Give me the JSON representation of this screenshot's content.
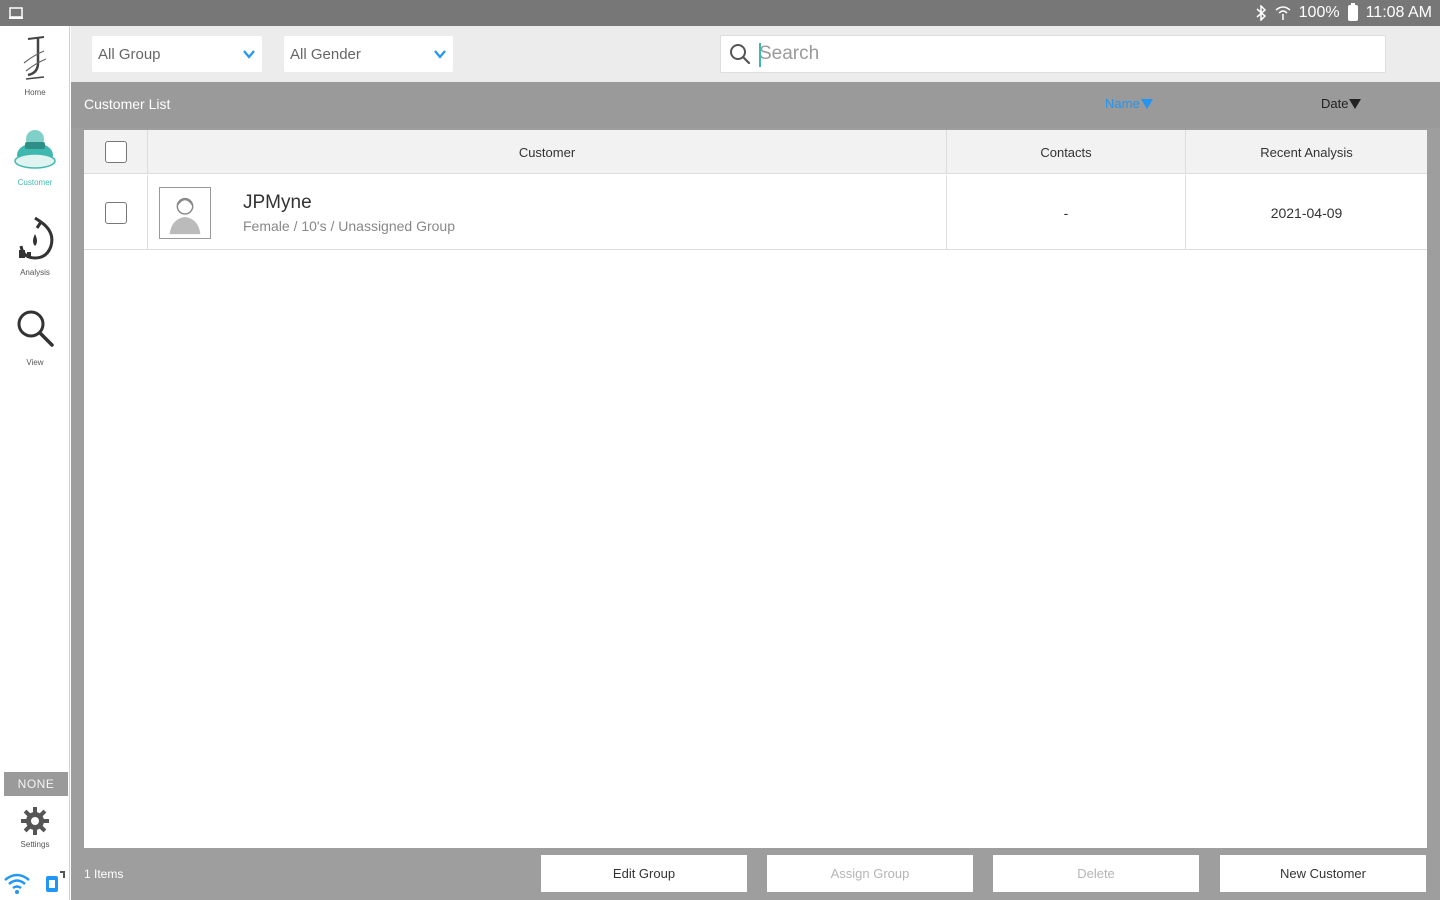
{
  "status_bar": {
    "battery": "100%",
    "time": "11:08 AM"
  },
  "sidebar": {
    "items": [
      {
        "label": "Home",
        "icon": "home-logo-icon"
      },
      {
        "label": "Customer",
        "icon": "customer-icon"
      },
      {
        "label": "Analysis",
        "icon": "analysis-icon"
      },
      {
        "label": "View",
        "icon": "search-icon"
      }
    ],
    "badge": "NONE",
    "settings_label": "Settings",
    "accent_color": "#3fb8af"
  },
  "filters": {
    "group": "All Group",
    "gender": "All Gender"
  },
  "search": {
    "placeholder": "Search",
    "value": ""
  },
  "list": {
    "title": "Customer List",
    "sort_name": "Name",
    "sort_date": "Date",
    "sort_active_color": "#2196f3"
  },
  "table": {
    "columns": [
      "Customer",
      "Contacts",
      "Recent Analysis"
    ],
    "rows": [
      {
        "name": "JPMyne",
        "details": "Female / 10's / Unassigned Group",
        "contacts": "-",
        "recent_analysis": "2021-04-09"
      }
    ]
  },
  "footer": {
    "count": "1 Items",
    "edit_group": "Edit Group",
    "assign_group": "Assign Group",
    "delete": "Delete",
    "new_customer": "New Customer"
  }
}
